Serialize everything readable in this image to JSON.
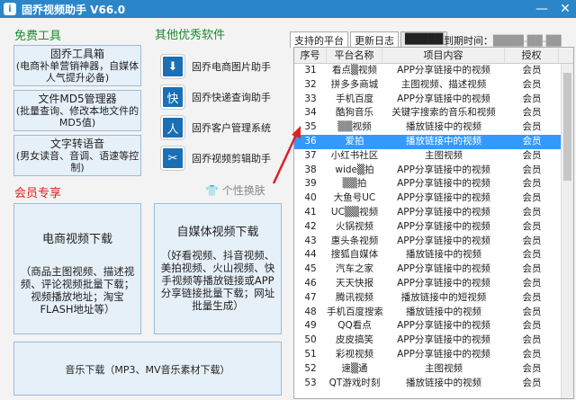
{
  "window": {
    "title": "固乔视频助手 V66.0",
    "app_icon": "i"
  },
  "free": {
    "title": "免费工具",
    "buttons": [
      {
        "t": "固乔工具箱",
        "s": "(电商补单营销神器，自媒体人气提升必备)"
      },
      {
        "t": "文件MD5管理器",
        "s": "(批量查询、修改本地文件的MD5值)"
      },
      {
        "t": "文字转语音",
        "s": "(男女读音、音调、语速等控制)"
      }
    ]
  },
  "other": {
    "title": "其他优秀软件",
    "items": [
      {
        "label": "固乔电商图片助手",
        "icon": "⬇"
      },
      {
        "label": "固乔快递查询助手",
        "icon": "快"
      },
      {
        "label": "固乔客户管理系统",
        "icon": "人"
      },
      {
        "label": "固乔视频剪辑助手",
        "icon": "✂"
      }
    ],
    "skin": "个性换肤"
  },
  "vip": {
    "title": "会员专享",
    "ecom": {
      "t": "电商视频下载",
      "s": "（商品主图视频、描述视频、评论视频批量下载；视频播放地址；淘宝FLASH地址等）"
    },
    "media": {
      "t": "自媒体视频下载",
      "s": "（好看视频、抖音视频、美拍视频、火山视频、快手视频等播放链接或APP分享链接批量下载；网址批量生成）"
    },
    "music": {
      "t": "音乐下载（MP3、MV音乐素材下载）"
    }
  },
  "tabs": [
    "支持的平台",
    "更新日志",
    "█████"
  ],
  "time": {
    "label": "到期时间：",
    "value": "████-██-██"
  },
  "table": {
    "headers": [
      "序号",
      "平台名称",
      "项目内容",
      "授权"
    ],
    "rows": [
      [
        "31",
        "看点▒视频",
        "APP分享链接中的视频",
        "会员"
      ],
      [
        "32",
        "拼多多商城",
        "主图视频、描述视频",
        "会员"
      ],
      [
        "33",
        "手机百度",
        "APP分享链接中的视频",
        "会员"
      ],
      [
        "34",
        "酷狗音乐",
        "关键字搜索的音乐和视频",
        "会员"
      ],
      [
        "35",
        "▒▒视频",
        "播放链接中的视频",
        "会员"
      ],
      [
        "36",
        "爱拍",
        "播放链接中的视频",
        "会员"
      ],
      [
        "37",
        "小红书社区",
        "主图视频",
        "会员"
      ],
      [
        "38",
        "wide▒拍",
        "APP分享链接中的视频",
        "会员"
      ],
      [
        "39",
        "▒▒拍",
        "APP分享链接中的视频",
        "会员"
      ],
      [
        "40",
        "大鱼号UC",
        "APP分享链接中的视频",
        "会员"
      ],
      [
        "41",
        "UC▒▒视频",
        "APP分享链接中的视频",
        "会员"
      ],
      [
        "42",
        "火锅视频",
        "APP分享链接中的视频",
        "会员"
      ],
      [
        "43",
        "惠头条视频",
        "APP分享链接中的视频",
        "会员"
      ],
      [
        "44",
        "搜狐自媒体",
        "播放链接中的视频",
        "会员"
      ],
      [
        "45",
        "汽车之家",
        "APP分享链接中的视频",
        "会员"
      ],
      [
        "46",
        "天天快报",
        "APP分享链接中的视频",
        "会员"
      ],
      [
        "47",
        "腾讯视频",
        "播放链接中的短视频",
        "会员"
      ],
      [
        "48",
        "手机百度搜索",
        "播放链接中的视频",
        "会员"
      ],
      [
        "49",
        "QQ看点",
        "APP分享链接中的视频",
        "会员"
      ],
      [
        "50",
        "皮皮搞笑",
        "APP分享链接中的视频",
        "会员"
      ],
      [
        "51",
        "彩视视频",
        "APP分享链接中的视频",
        "会员"
      ],
      [
        "52",
        "速▒通",
        "主图视频",
        "会员"
      ],
      [
        "53",
        "QT游戏时刻",
        "播放链接中的视频",
        "会员"
      ]
    ]
  }
}
